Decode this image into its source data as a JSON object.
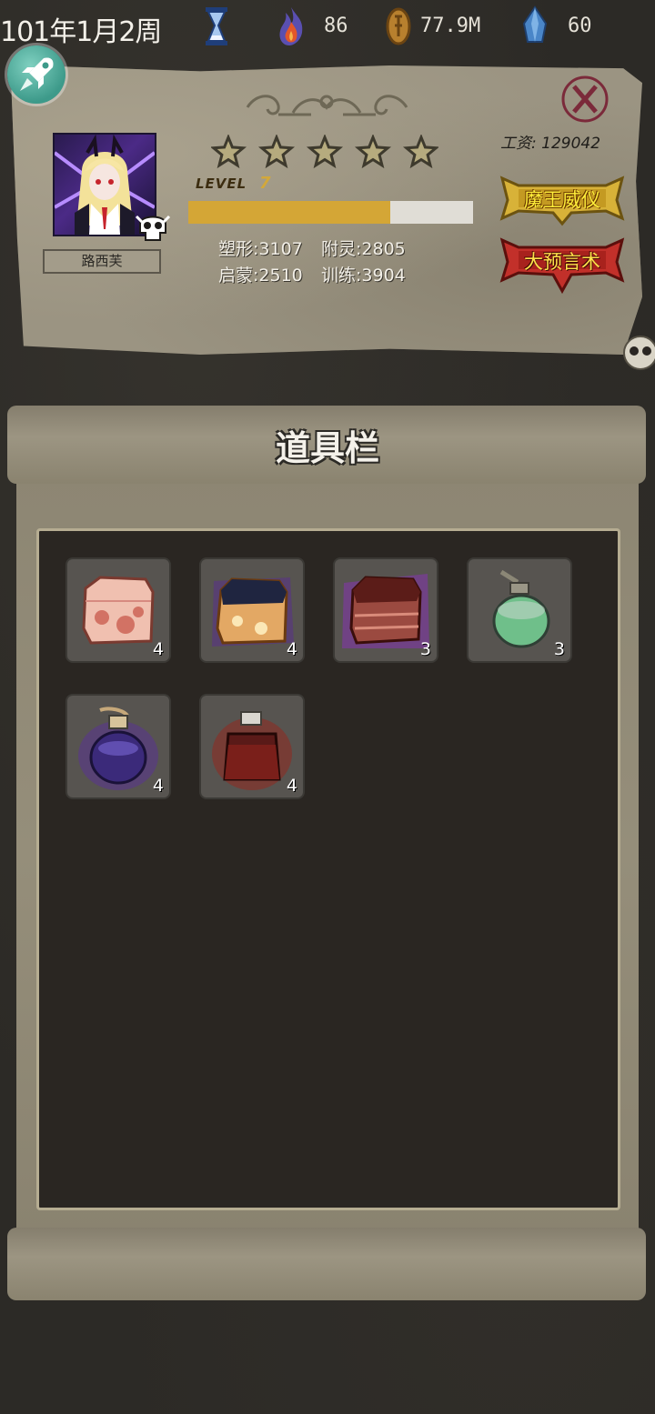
{
  "status": {
    "date": "101年1月2周",
    "flame": "86",
    "coin": "77.9M",
    "crystal": "60"
  },
  "character": {
    "name": "路西芙",
    "salary_label": "工资:",
    "salary_value": "129042",
    "stars": 5,
    "level_label": "LEVEL",
    "level": "7",
    "xp_fraction": 0.71,
    "stats": {
      "shape_label": "塑形",
      "shape_value": "3107",
      "enchant_label": "附灵",
      "enchant_value": "2805",
      "enlighten_label": "启蒙",
      "enlighten_value": "2510",
      "train_label": "训练",
      "train_value": "3904"
    },
    "banners": {
      "gold": "魔王威仪",
      "red": "大预言术"
    }
  },
  "inventory": {
    "title": "道具栏",
    "items": [
      {
        "kind": "meat-block-pink",
        "count": "4"
      },
      {
        "kind": "meat-block-charred",
        "count": "4"
      },
      {
        "kind": "meat-block-dark",
        "count": "3"
      },
      {
        "kind": "potion-green",
        "count": "3"
      },
      {
        "kind": "potion-purple",
        "count": "4"
      },
      {
        "kind": "potion-red",
        "count": "4"
      }
    ]
  },
  "colors": {
    "xp_fill": "#d4a636",
    "gold_banner": "#d8b238",
    "red_banner": "#c2302a",
    "gold_banner_text": "#ffee3a",
    "red_banner_text": "#ffe24a"
  }
}
